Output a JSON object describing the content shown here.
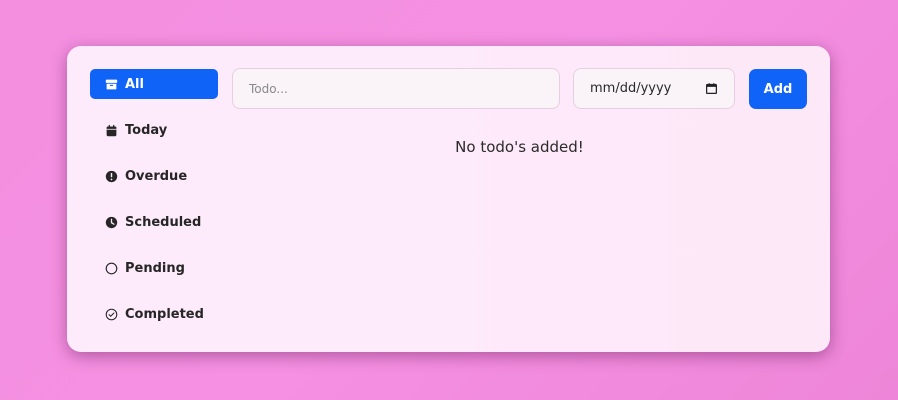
{
  "sidebar": {
    "items": [
      {
        "label": "All",
        "icon": "archive-icon",
        "active": true
      },
      {
        "label": "Today",
        "icon": "calendar-icon",
        "active": false
      },
      {
        "label": "Overdue",
        "icon": "exclamation-circle-icon",
        "active": false
      },
      {
        "label": "Scheduled",
        "icon": "clock-icon",
        "active": false
      },
      {
        "label": "Pending",
        "icon": "circle-outline-icon",
        "active": false
      },
      {
        "label": "Completed",
        "icon": "check-circle-icon",
        "active": false
      }
    ]
  },
  "form": {
    "todo_placeholder": "Todo...",
    "todo_value": "",
    "date_placeholder": "mm/dd/yyyy",
    "add_label": "Add"
  },
  "main": {
    "empty_message": "No todo's added!"
  },
  "colors": {
    "accent": "#0f63f7",
    "card_bg": "#fdebfb",
    "page_bg": "#f48fe0"
  }
}
